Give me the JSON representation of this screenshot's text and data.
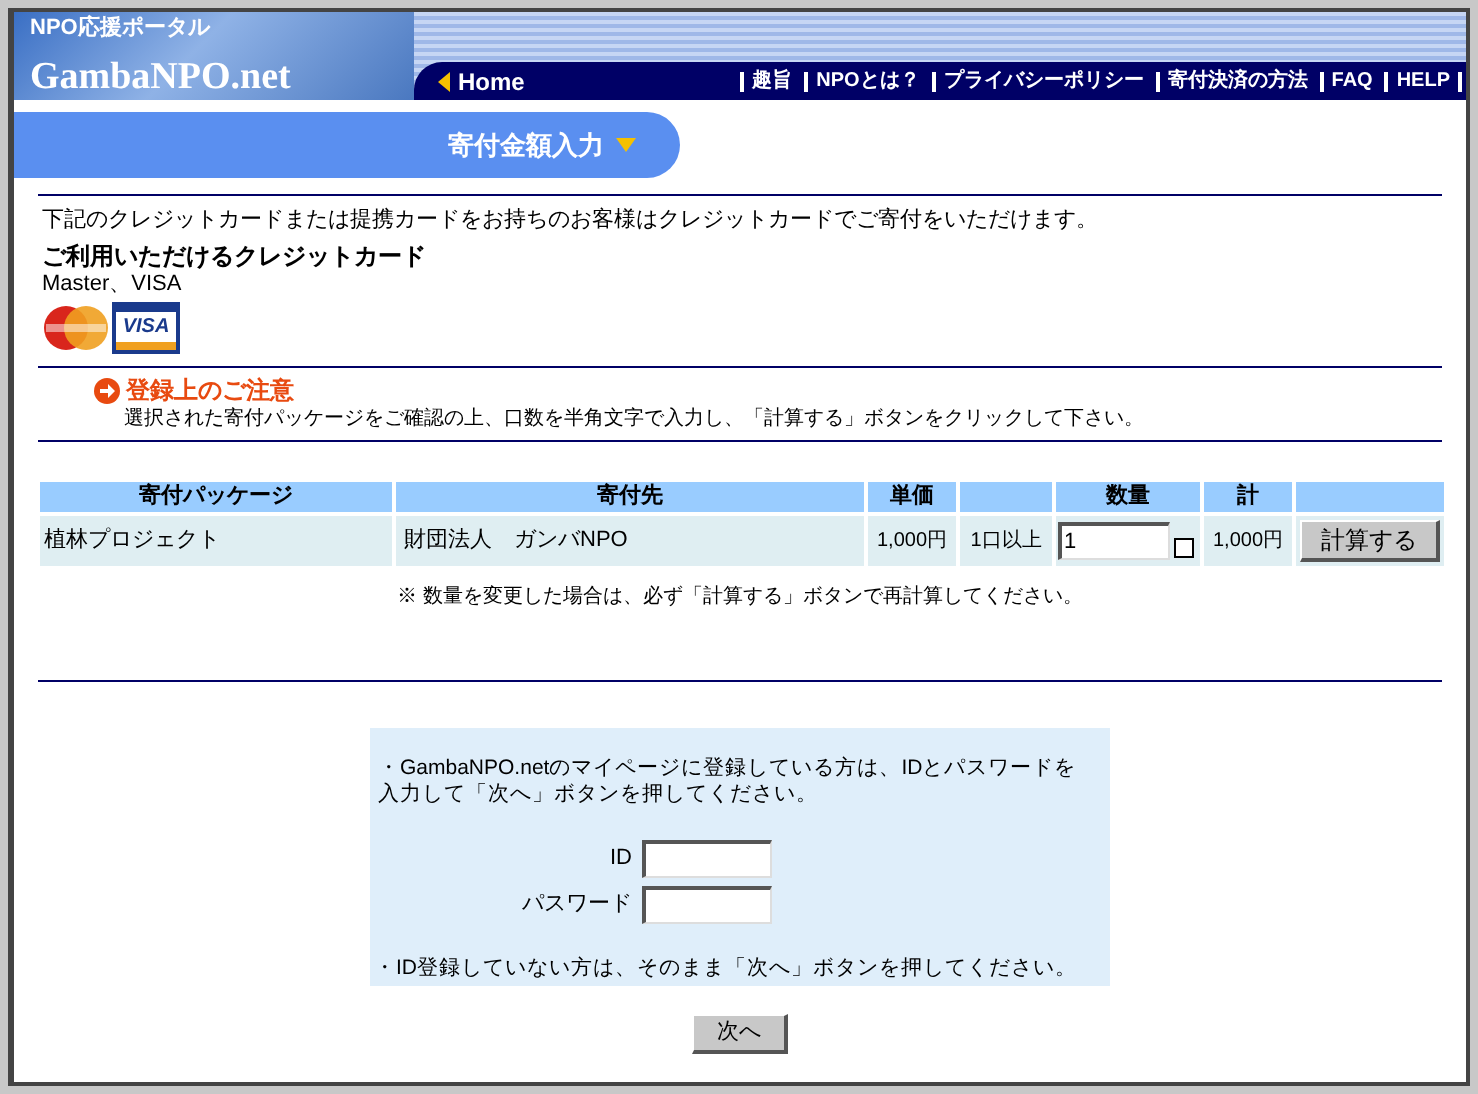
{
  "header": {
    "tagline": "NPO応援ポータル",
    "logo": "GambaNPO.net",
    "home": "Home",
    "nav": [
      "趣旨",
      "NPOとは？",
      "プライバシーポリシー",
      "寄付決済の方法",
      "FAQ",
      "HELP"
    ]
  },
  "step_tab": {
    "label": "寄付金額入力"
  },
  "intro": "下記のクレジットカードまたは提携カードをお持ちのお客様はクレジットカードでご寄付をいただけます。",
  "cards": {
    "title": "ご利用いただけるクレジットカード",
    "names": "Master、VISA",
    "logos": [
      {
        "kind": "master"
      },
      {
        "kind": "visa",
        "label": "VISA"
      }
    ]
  },
  "notice": {
    "title": "登録上のご注意",
    "text": "選択された寄付パッケージをご確認の上、口数を半角文字で入力し、「計算する」ボタンをクリックして下さい。"
  },
  "table": {
    "columns": [
      "寄付パッケージ",
      "寄付先",
      "単価",
      "",
      "数量",
      "計",
      ""
    ],
    "rows": [
      {
        "package": "植林プロジェクト",
        "recipient": "財団法人　ガンバNPO",
        "unit_price": "1,000円",
        "minimum": "1口以上",
        "quantity": "1",
        "checked": false,
        "total": "1,000円",
        "button": "計算する"
      }
    ]
  },
  "table_note": "※ 数量を変更した場合は、必ず「計算する」ボタンで再計算してください。",
  "login": {
    "text1": "・GambaNPO.netのマイページに登録している方は、IDとパスワードを入力して「次へ」ボタンを押してください。",
    "fields": [
      {
        "label": "ID"
      },
      {
        "label": "パスワード"
      }
    ],
    "text2": "・ID登録していない方は、そのまま「次へ」ボタンを押してください。"
  },
  "next_button": "次へ"
}
